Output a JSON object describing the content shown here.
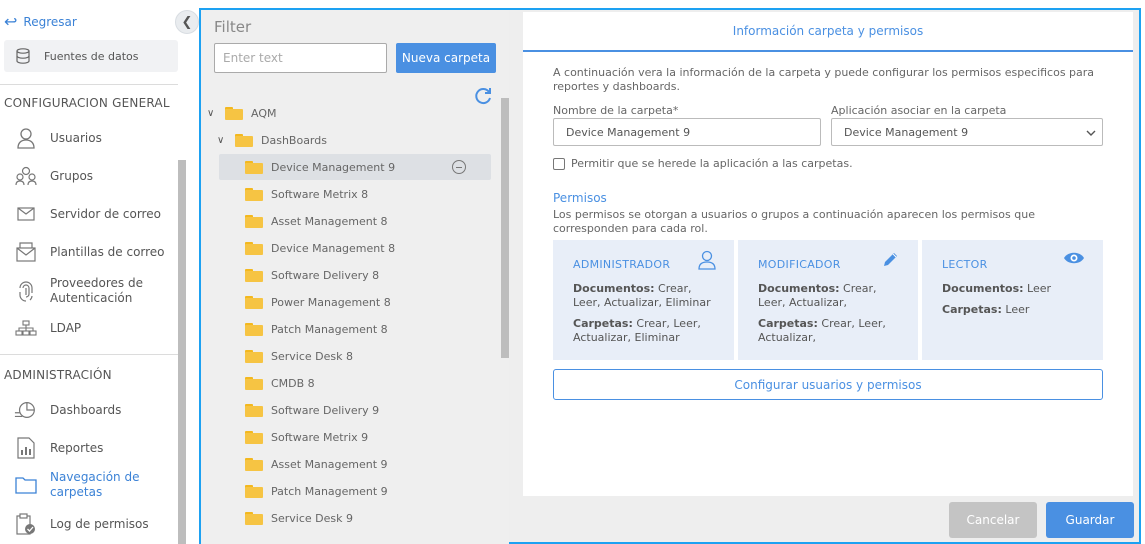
{
  "sidebar": {
    "back_label": "Regresar",
    "sources_label": "Fuentes de datos",
    "section_general": "CONFIGURACION GENERAL",
    "section_admin": "ADMINISTRACIÓN",
    "items_general": [
      {
        "label": "Usuarios",
        "icon": "user-icon"
      },
      {
        "label": "Grupos",
        "icon": "group-icon"
      },
      {
        "label": "Servidor de correo",
        "icon": "mail-icon"
      },
      {
        "label": "Plantillas de correo",
        "icon": "mail-template-icon"
      },
      {
        "label": "Proveedores de Autenticación",
        "icon": "fingerprint-icon"
      },
      {
        "label": "LDAP",
        "icon": "ldap-icon"
      }
    ],
    "items_admin": [
      {
        "label": "Dashboards",
        "icon": "dashboard-icon"
      },
      {
        "label": "Reportes",
        "icon": "report-icon"
      },
      {
        "label": "Navegación de carpetas",
        "icon": "folder-nav-icon",
        "active": true
      },
      {
        "label": "Log de permisos",
        "icon": "clipboard-check-icon"
      }
    ]
  },
  "folders": {
    "title": "Filter",
    "search_placeholder": "Enter text",
    "new_folder_label": "Nueva carpeta",
    "tree_root": "AQM",
    "tree_group": "DashBoards",
    "items": [
      "Device Management 9",
      "Software Metrix 8",
      "Asset Management 8",
      "Device Management 8",
      "Software Delivery 8",
      "Power Management 8",
      "Patch Management 8",
      "Service Desk 8",
      "CMDB 8",
      "Software Delivery 9",
      "Software Metrix 9",
      "Asset Management 9",
      "Patch Management 9",
      "Service Desk 9"
    ],
    "selected": "Device Management 9"
  },
  "details": {
    "header": "Información carpeta y permisos",
    "description": "A continuación vera la información de la carpeta y puede configurar los permisos especificos para reportes y dashboards.",
    "name_label": "Nombre de la carpeta*",
    "name_value": "Device Management 9",
    "app_label": "Aplicación asociar en la carpeta",
    "app_value": "Device Management 9",
    "inherit_label": "Permitir que se herede la aplicación a las carpetas.",
    "perms_title": "Permisos",
    "perms_desc": "Los permisos se otorgan a usuarios o grupos a continuación aparecen los permisos que corresponden para cada rol.",
    "cards": [
      {
        "title": "ADMINISTRADOR",
        "icon": "user-icon",
        "docs_key": "Documentos:",
        "docs_val": " Crear, Leer, Actualizar, Eliminar",
        "folders_key": "Carpetas:",
        "folders_val": " Crear, Leer, Actualizar, Eliminar"
      },
      {
        "title": "MODIFICADOR",
        "icon": "pencil-icon",
        "docs_key": "Documentos:",
        "docs_val": " Crear, Leer, Actualizar,",
        "folders_key": "Carpetas:",
        "folders_val": " Crear, Leer, Actualizar,"
      },
      {
        "title": "LECTOR",
        "icon": "eye-icon",
        "docs_key": "Documentos:",
        "docs_val": " Leer",
        "folders_key": "Carpetas:",
        "folders_val": " Leer"
      }
    ],
    "config_label": "Configurar usuarios y permisos"
  },
  "footer": {
    "cancel_label": "Cancelar",
    "save_label": "Guardar"
  },
  "colors": {
    "accent": "#4a90e2",
    "frame_border": "#1da1f2",
    "folder": "#f6c443",
    "card_bg": "#e8eef8"
  }
}
